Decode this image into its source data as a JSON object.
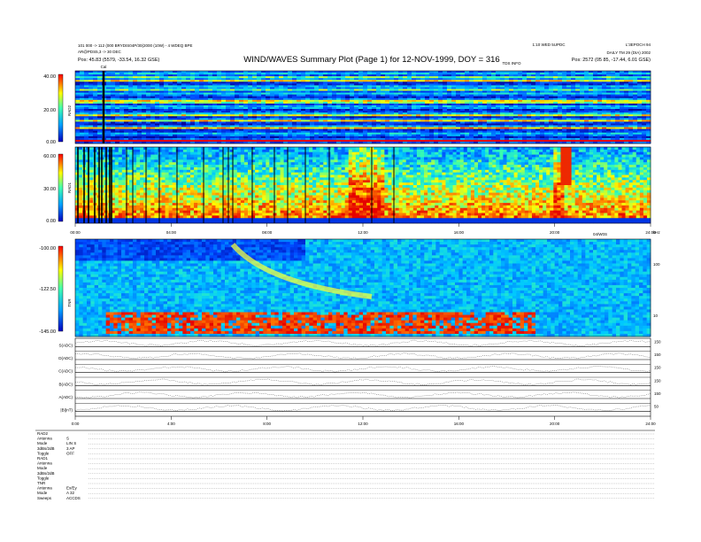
{
  "header": {
    "title": "WIND/WAVES Summary Plot (Page 1) for 12-NOV-1999, DOY = 316",
    "left_line1": "101 000 -> 112 (000 BRYDIS04P/30(2000 (10W) - 4 WDEQ BPE",
    "left_line2": "AR@PDS5,3 -> 30 DEC",
    "left_line3": "Pos:   45.83 (5579, -33.54, 16.32 GSE)",
    "right_line1": "1:10 WED 5UPDC",
    "right_line2": "L'3EPOCH 94",
    "right_line3": "DAILY TM 29 (DIA) 2002",
    "right_line4": "Pos:   2572 (05 85, -17.44, 6.01 GSE)",
    "tdsinfo": "TDS INFO",
    "marker": "Cal"
  },
  "chart_data": [
    {
      "type": "heatmap",
      "panel": "RAD2",
      "ylabel": "RAD2",
      "ylim": [
        0,
        40
      ],
      "yticks": [
        "40.00",
        "20.00",
        "0.00"
      ]
    },
    {
      "type": "heatmap",
      "panel": "RAD1",
      "ylabel": "RAD1",
      "ylim": [
        0,
        60
      ],
      "yticks": [
        "60.00",
        "30.00",
        "0.00"
      ],
      "xticks": [
        "00:00",
        "04:00",
        "08:00",
        "12:00",
        "16:00",
        "20:00",
        "24:00"
      ],
      "x_extra_label": "04/W0S"
    },
    {
      "type": "heatmap",
      "panel": "TNR",
      "ylabel": "TNR",
      "ylim": [
        -145,
        -100
      ],
      "yticks": [
        "-100.00",
        "-122.50",
        "-145.00"
      ],
      "right_ticks": [
        "100",
        "10"
      ],
      "right_unit": "kHz"
    },
    {
      "type": "line",
      "panel": "wave channels",
      "rows": [
        {
          "label": "S(ADC)",
          "right": "150"
        },
        {
          "label": "D(ADC)",
          "right": "150"
        },
        {
          "label": "C(ADC)",
          "right": "150"
        },
        {
          "label": "B(ADC)",
          "right": "150"
        },
        {
          "label": "A(ADC)",
          "right": "150"
        },
        {
          "label": "|B|(nT)",
          "right": "50"
        }
      ],
      "xticks": [
        "0:00",
        "4:00",
        "8:00",
        "12:00",
        "16:00",
        "20:00",
        "24:00"
      ]
    }
  ],
  "footer": {
    "rows": [
      {
        "label": "RAD2",
        "value": ""
      },
      {
        "label": "Antenna",
        "value": "S"
      },
      {
        "label": "Mode",
        "value": "LIN S"
      },
      {
        "label": "3dBs/2dB",
        "value": "3 AP"
      },
      {
        "label": "Toggle",
        "value": "OFF"
      },
      {
        "label": "RAD1",
        "value": ""
      },
      {
        "label": "Antenna",
        "value": ""
      },
      {
        "label": "Mode",
        "value": ""
      },
      {
        "label": "3dBs/2dB",
        "value": ""
      },
      {
        "label": "Toggle",
        "value": ""
      },
      {
        "label": "TNR",
        "value": ""
      },
      {
        "label": "Antenna",
        "value": "Ex/Ey"
      },
      {
        "label": "Mode",
        "value": "A 32"
      },
      {
        "label": "Sweeps",
        "value": "ACCDS"
      }
    ]
  }
}
